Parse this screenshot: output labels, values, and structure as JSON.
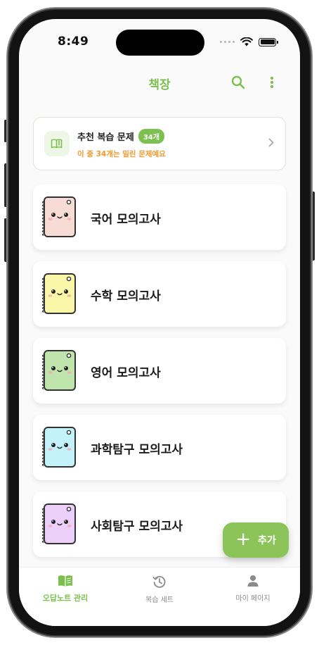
{
  "status_bar": {
    "time": "8:49"
  },
  "header": {
    "title": "책장",
    "search_icon": "search-icon",
    "more_icon": "more-vertical-icon"
  },
  "recommend": {
    "title": "추천 복습 문제",
    "badge": "34개",
    "subtitle": "이 중 34개는 밀린 문제예요",
    "icon": "book-pen-icon"
  },
  "notebooks": [
    {
      "label": "국어 모의고사",
      "color": "#f7dcd6"
    },
    {
      "label": "수학 모의고사",
      "color": "#fbf7a8"
    },
    {
      "label": "영어 모의고사",
      "color": "#bfe5ac"
    },
    {
      "label": "과학탐구 모의고사",
      "color": "#c3f2fb"
    },
    {
      "label": "사회탐구 모의고사",
      "color": "#eccffb"
    }
  ],
  "fab": {
    "label": "추가"
  },
  "tabs": [
    {
      "label": "오답노트 관리",
      "icon": "open-book-icon",
      "active": true
    },
    {
      "label": "복습 세트",
      "icon": "history-icon",
      "active": false
    },
    {
      "label": "마이 페이지",
      "icon": "person-icon",
      "active": false
    }
  ],
  "colors": {
    "accent": "#7cc04f",
    "warning": "#f2982c"
  }
}
